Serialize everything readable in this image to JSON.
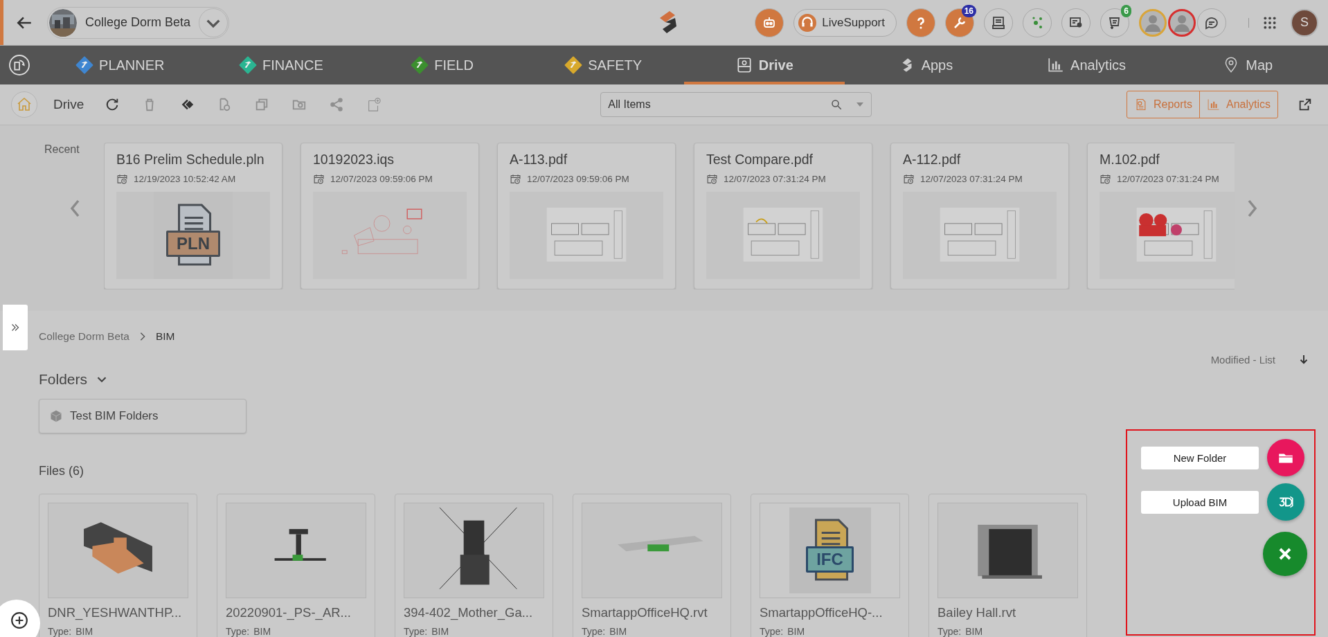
{
  "project": {
    "name": "College Dorm Beta"
  },
  "header": {
    "icons": [
      {
        "kind": "robot"
      },
      {
        "kind": "support",
        "label": "LiveSupport"
      },
      {
        "kind": "help"
      },
      {
        "kind": "wrench",
        "badge": "16"
      },
      {
        "kind": "tray"
      },
      {
        "kind": "network"
      },
      {
        "kind": "contact"
      },
      {
        "kind": "cart",
        "badge": "6"
      },
      {
        "kind": "avatar",
        "color": "#d9a53a"
      },
      {
        "kind": "avatar",
        "color": "#d62f2f"
      },
      {
        "kind": "chat"
      },
      {
        "kind": "apps"
      },
      {
        "kind": "user",
        "label": "S"
      }
    ]
  },
  "nav": [
    {
      "label": "PLANNER",
      "kind": "tool",
      "color": "#3f86d1",
      "selected": false
    },
    {
      "label": "FINANCE",
      "kind": "tool",
      "color": "#2bb592",
      "selected": false
    },
    {
      "label": "FIELD",
      "kind": "tool",
      "color": "#3c8f2f",
      "selected": false
    },
    {
      "label": "SAFETY",
      "kind": "tool",
      "color": "#d8a92c",
      "selected": false
    },
    {
      "label": "Drive",
      "kind": "drive",
      "selected": true
    },
    {
      "label": "Apps",
      "kind": "apps",
      "selected": false
    },
    {
      "label": "Analytics",
      "kind": "analytics",
      "selected": false
    },
    {
      "label": "Map",
      "kind": "map",
      "selected": false
    }
  ],
  "toolbar": {
    "title": "Drive",
    "tools": [
      {
        "kind": "refresh",
        "disabled": false
      },
      {
        "kind": "trash",
        "disabled": true
      },
      {
        "kind": "move",
        "disabled": false
      },
      {
        "kind": "file-add",
        "disabled": true
      },
      {
        "kind": "copy",
        "disabled": true
      },
      {
        "kind": "folder-photo",
        "disabled": true
      },
      {
        "kind": "share",
        "disabled": true
      },
      {
        "kind": "pdf-add",
        "disabled": true
      }
    ],
    "filter": {
      "value": "All Items"
    },
    "reports": "Reports",
    "analytics": "Analytics"
  },
  "recent": {
    "label": "Recent",
    "items": [
      {
        "name": "B16 Prelim Schedule.pln",
        "date": "12/19/2023 10:52:42 AM",
        "kind": "file-icon",
        "badge": "PLN"
      },
      {
        "name": "10192023.iqs",
        "date": "12/07/2023 09:59:06 PM",
        "kind": "picture"
      },
      {
        "name": "A-113.pdf",
        "date": "12/07/2023 09:59:06 PM",
        "kind": "picture"
      },
      {
        "name": "Test Compare.pdf",
        "date": "12/07/2023 07:31:24 PM",
        "kind": "picture"
      },
      {
        "name": "A-112.pdf",
        "date": "12/07/2023 07:31:24 PM",
        "kind": "picture"
      },
      {
        "name": "M.102.pdf",
        "date": "12/07/2023 07:31:24 PM",
        "kind": "picture"
      }
    ]
  },
  "breadcrumb": [
    {
      "label": "College Dorm Beta",
      "selected": false
    },
    {
      "label": "BIM",
      "selected": true
    }
  ],
  "sort": {
    "label": "Modified - List"
  },
  "folders": {
    "title": "Folders",
    "expanded": true,
    "items": [
      {
        "name": "Test BIM Folders"
      }
    ]
  },
  "files": {
    "title": "Files (6)",
    "items": [
      {
        "name": "DNR_YESHWANTHP...",
        "type_label": "Type:",
        "type": "BIM",
        "kind": "picture"
      },
      {
        "name": "20220901-_PS-_AR...",
        "type_label": "Type:",
        "type": "BIM",
        "kind": "picture"
      },
      {
        "name": "394-402_Mother_Ga...",
        "type_label": "Type:",
        "type": "BIM",
        "kind": "picture"
      },
      {
        "name": "SmartappOfficeHQ.rvt",
        "type_label": "Type:",
        "type": "BIM",
        "kind": "picture"
      },
      {
        "name": "SmartappOfficeHQ-...",
        "type_label": "Type:",
        "type": "BIM",
        "kind": "file-icon",
        "badge": "IFC"
      },
      {
        "name": "Bailey Hall.rvt",
        "type_label": "Type:",
        "type": "BIM",
        "kind": "picture"
      }
    ]
  },
  "fab": {
    "expanded": true,
    "actions": [
      {
        "label": "New Folder",
        "kind": "folder",
        "color": "#e8175d"
      },
      {
        "label": "Upload BIM",
        "kind": "upload3d",
        "color": "#12968a"
      }
    ]
  }
}
